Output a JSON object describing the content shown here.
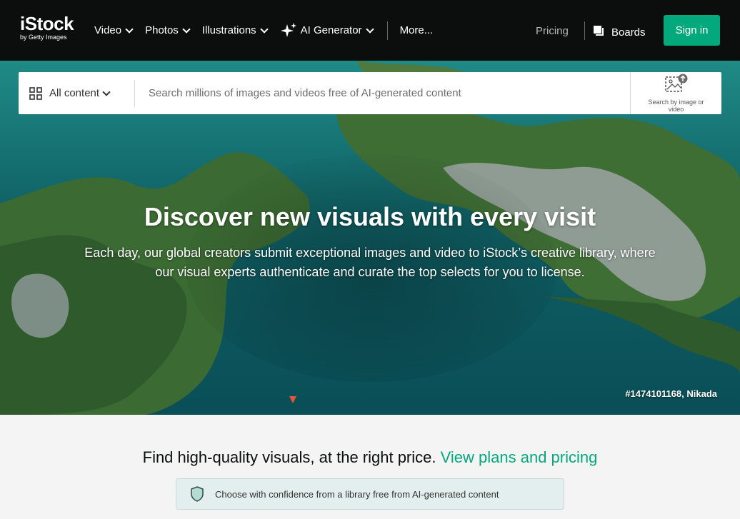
{
  "header": {
    "logo_main": "iStock",
    "logo_sub": "by Getty Images",
    "nav": [
      {
        "label": "Video"
      },
      {
        "label": "Photos"
      },
      {
        "label": "Illustrations"
      },
      {
        "label": "AI Generator"
      },
      {
        "label": "More..."
      }
    ],
    "pricing_label": "Pricing",
    "boards_label": "Boards",
    "signin_label": "Sign in"
  },
  "search": {
    "filter_label": "All content",
    "placeholder": "Search millions of images and videos free of AI-generated content",
    "image_search_label": "Search by image or video"
  },
  "hero": {
    "title": "Discover new visuals with every visit",
    "description": "Each day, our global creators submit exceptional images and video to iStock’s creative library, where our visual experts authenticate and curate the top selects for you to license.",
    "credit": "#1474101168, Nikada"
  },
  "pricing_banner": {
    "text": "Find high-quality visuals, at the right price.",
    "link_label": "View plans and pricing"
  },
  "confidence": {
    "text": "Choose with confidence from a library free from AI-generated content"
  },
  "colors": {
    "header_bg": "#0c0d0d",
    "accent": "#03a87c",
    "page_bg": "#f4f4f4",
    "confidence_bg": "#e3efee"
  },
  "icons": [
    "sparkle-icon",
    "boards-icon",
    "grid-icon",
    "image-search-icon",
    "shield-icon",
    "chevron-down-icon"
  ]
}
